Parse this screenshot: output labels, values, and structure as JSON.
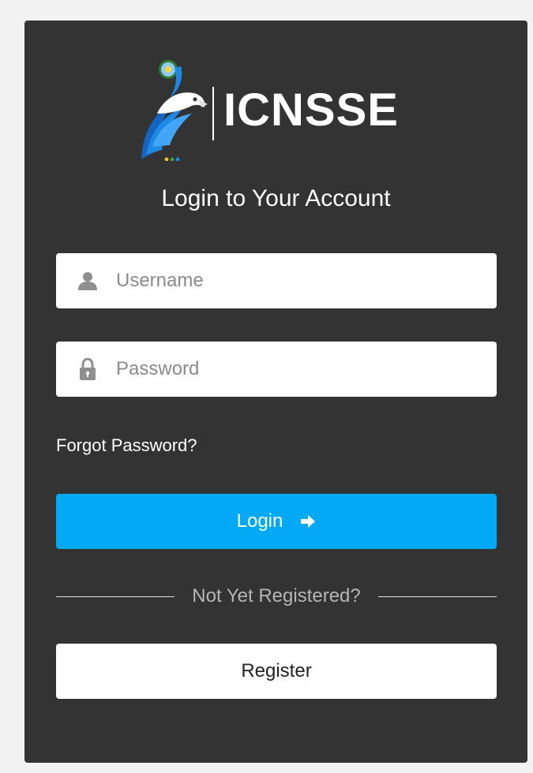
{
  "brand": {
    "name": "ICNSSE",
    "logo_icon": "eagle-emblem-icon",
    "colors": {
      "blue": "#1e88e5",
      "white": "#ffffff",
      "dot1": "#fbc02d",
      "dot2": "#43a047",
      "dot3": "#1e88e5"
    }
  },
  "heading": "Login to Your Account",
  "form": {
    "username": {
      "icon": "user-icon",
      "placeholder": "Username",
      "value": ""
    },
    "password": {
      "icon": "lock-icon",
      "placeholder": "Password",
      "value": ""
    },
    "forgot_link": "Forgot Password?",
    "login_button": {
      "label": "Login",
      "icon": "arrow-right-icon",
      "color": "#03a9f4"
    },
    "divider_text": "Not Yet Registered?",
    "register_button": {
      "label": "Register"
    }
  },
  "theme": {
    "page_background": "#f2f2f2",
    "card_background": "#333333"
  }
}
